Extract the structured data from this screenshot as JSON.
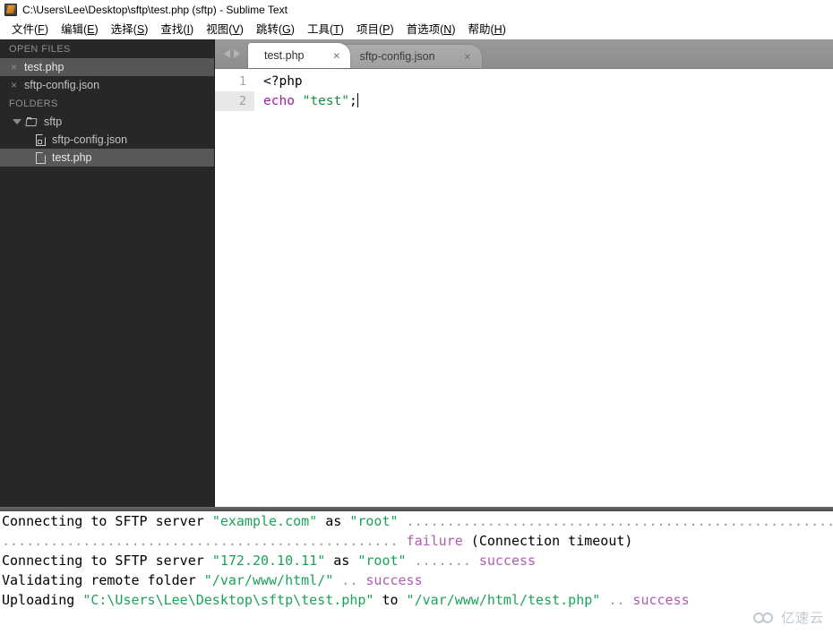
{
  "window": {
    "title": "C:\\Users\\Lee\\Desktop\\sftp\\test.php (sftp) - Sublime Text",
    "app_icon": "sublime-text-icon"
  },
  "menubar": {
    "items": [
      {
        "label": "文件(F)",
        "name": "menu-file"
      },
      {
        "label": "编辑(E)",
        "name": "menu-edit"
      },
      {
        "label": "选择(S)",
        "name": "menu-selection"
      },
      {
        "label": "查找(I)",
        "name": "menu-find"
      },
      {
        "label": "视图(V)",
        "name": "menu-view"
      },
      {
        "label": "跳转(G)",
        "name": "menu-goto"
      },
      {
        "label": "工具(T)",
        "name": "menu-tools"
      },
      {
        "label": "项目(P)",
        "name": "menu-project"
      },
      {
        "label": "首选项(N)",
        "name": "menu-preferences"
      },
      {
        "label": "帮助(H)",
        "name": "menu-help"
      }
    ]
  },
  "sidebar": {
    "open_files_header": "OPEN FILES",
    "folders_header": "FOLDERS",
    "open_files": [
      {
        "label": "test.php",
        "close": "×",
        "selected": true
      },
      {
        "label": "sftp-config.json",
        "close": "×",
        "selected": false
      }
    ],
    "folders": [
      {
        "label": "sftp",
        "type": "folder",
        "expanded": true
      },
      {
        "label": "sftp-config.json",
        "type": "file-json",
        "selected": false
      },
      {
        "label": "test.php",
        "type": "file",
        "selected": true
      }
    ]
  },
  "tabs": {
    "nav_prev": "prev-arrow",
    "nav_next": "next-arrow",
    "items": [
      {
        "label": "test.php",
        "close": "×",
        "active": true
      },
      {
        "label": "sftp-config.json",
        "close": "×",
        "active": false
      }
    ]
  },
  "editor": {
    "line_numbers": [
      "1",
      "2"
    ],
    "current_line": 2,
    "lines": [
      {
        "tokens": [
          {
            "text": "<?php",
            "type": "plain"
          }
        ]
      },
      {
        "tokens": [
          {
            "text": "echo",
            "type": "keyword"
          },
          {
            "text": " ",
            "type": "plain"
          },
          {
            "text": "\"test\"",
            "type": "string"
          },
          {
            "text": ";",
            "type": "plain"
          }
        ]
      }
    ]
  },
  "console": {
    "lines": [
      {
        "segments": [
          {
            "text": "Connecting to SFTP server ",
            "type": "plain"
          },
          {
            "text": "\"example.com\"",
            "type": "string"
          },
          {
            "text": " as ",
            "type": "plain"
          },
          {
            "text": "\"root\"",
            "type": "string"
          },
          {
            "text": " ........................................................",
            "type": "dots"
          }
        ]
      },
      {
        "segments": [
          {
            "text": "................................................. ",
            "type": "dots"
          },
          {
            "text": "failure",
            "type": "failure"
          },
          {
            "text": " (Connection timeout)",
            "type": "plain"
          }
        ]
      },
      {
        "segments": [
          {
            "text": "Connecting to SFTP server ",
            "type": "plain"
          },
          {
            "text": "\"172.20.10.11\"",
            "type": "string"
          },
          {
            "text": " as ",
            "type": "plain"
          },
          {
            "text": "\"root\"",
            "type": "string"
          },
          {
            "text": " ....... ",
            "type": "dots"
          },
          {
            "text": "success",
            "type": "success"
          }
        ]
      },
      {
        "segments": [
          {
            "text": "Validating remote folder ",
            "type": "plain"
          },
          {
            "text": "\"/var/www/html/\"",
            "type": "string"
          },
          {
            "text": " .. ",
            "type": "dots"
          },
          {
            "text": "success",
            "type": "success"
          }
        ]
      },
      {
        "segments": [
          {
            "text": "Uploading ",
            "type": "plain"
          },
          {
            "text": "\"C:\\Users\\Lee\\Desktop\\sftp\\test.php\"",
            "type": "string"
          },
          {
            "text": " to ",
            "type": "plain"
          },
          {
            "text": "\"/var/www/html/test.php\"",
            "type": "string"
          },
          {
            "text": " .. ",
            "type": "dots"
          },
          {
            "text": "success",
            "type": "success"
          }
        ]
      }
    ]
  },
  "watermark": {
    "text": "亿速云",
    "icon": "cloud-icon"
  },
  "colors": {
    "sidebar_bg": "#272727",
    "tabbar_bg": "#9a9a9a",
    "keyword": "#a11f9e",
    "string": "#178a3c",
    "console_string": "#1ba35a",
    "console_status": "#b05cb0"
  }
}
